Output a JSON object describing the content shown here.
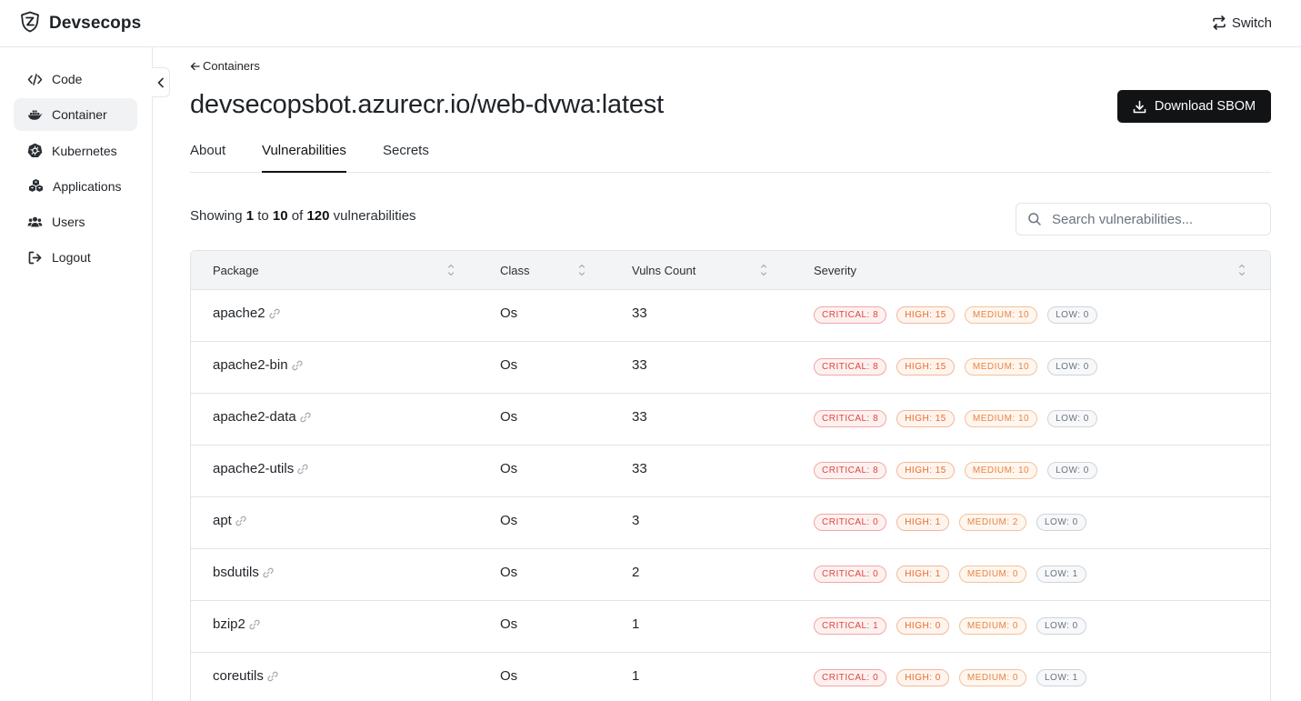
{
  "app": {
    "name": "Devsecops",
    "switch_label": "Switch"
  },
  "sidebar": {
    "items": [
      {
        "label": "Code",
        "icon": "code-icon",
        "active": false
      },
      {
        "label": "Container",
        "icon": "docker-icon",
        "active": true
      },
      {
        "label": "Kubernetes",
        "icon": "kubernetes-icon",
        "active": false
      },
      {
        "label": "Applications",
        "icon": "boxes-icon",
        "active": false
      },
      {
        "label": "Users",
        "icon": "users-icon",
        "active": false
      },
      {
        "label": "Logout",
        "icon": "logout-icon",
        "active": false
      }
    ]
  },
  "header": {
    "back_label": "Containers",
    "title": "devsecopsbot.azurecr.io/web-dvwa:latest",
    "download_label": "Download SBOM"
  },
  "tabs": [
    {
      "label": "About",
      "active": false
    },
    {
      "label": "Vulnerabilities",
      "active": true
    },
    {
      "label": "Secrets",
      "active": false
    }
  ],
  "summary": {
    "prefix": "Showing",
    "from": "1",
    "to_word": "to",
    "to": "10",
    "of_word": "of",
    "total": "120",
    "suffix": "vulnerabilities"
  },
  "search": {
    "placeholder": "Search vulnerabilities..."
  },
  "table": {
    "columns": [
      "Package",
      "Class",
      "Vulns Count",
      "Severity"
    ],
    "rows": [
      {
        "package": "apache2",
        "class": "Os",
        "count": "33",
        "critical": "CRITICAL: 8",
        "high": "HIGH: 15",
        "medium": "MEDIUM: 10",
        "low": "LOW: 0"
      },
      {
        "package": "apache2-bin",
        "class": "Os",
        "count": "33",
        "critical": "CRITICAL: 8",
        "high": "HIGH: 15",
        "medium": "MEDIUM: 10",
        "low": "LOW: 0"
      },
      {
        "package": "apache2-data",
        "class": "Os",
        "count": "33",
        "critical": "CRITICAL: 8",
        "high": "HIGH: 15",
        "medium": "MEDIUM: 10",
        "low": "LOW: 0"
      },
      {
        "package": "apache2-utils",
        "class": "Os",
        "count": "33",
        "critical": "CRITICAL: 8",
        "high": "HIGH: 15",
        "medium": "MEDIUM: 10",
        "low": "LOW: 0"
      },
      {
        "package": "apt",
        "class": "Os",
        "count": "3",
        "critical": "CRITICAL: 0",
        "high": "HIGH: 1",
        "medium": "MEDIUM: 2",
        "low": "LOW: 0"
      },
      {
        "package": "bsdutils",
        "class": "Os",
        "count": "2",
        "critical": "CRITICAL: 0",
        "high": "HIGH: 1",
        "medium": "MEDIUM: 0",
        "low": "LOW: 1"
      },
      {
        "package": "bzip2",
        "class": "Os",
        "count": "1",
        "critical": "CRITICAL: 1",
        "high": "HIGH: 0",
        "medium": "MEDIUM: 0",
        "low": "LOW: 0"
      },
      {
        "package": "coreutils",
        "class": "Os",
        "count": "1",
        "critical": "CRITICAL: 0",
        "high": "HIGH: 0",
        "medium": "MEDIUM: 0",
        "low": "LOW: 1"
      }
    ]
  },
  "colors": {
    "primary_button": "#111315",
    "critical": "#e0443e",
    "high": "#ea6a2a",
    "medium": "#e9843f",
    "low": "#6b7280"
  }
}
